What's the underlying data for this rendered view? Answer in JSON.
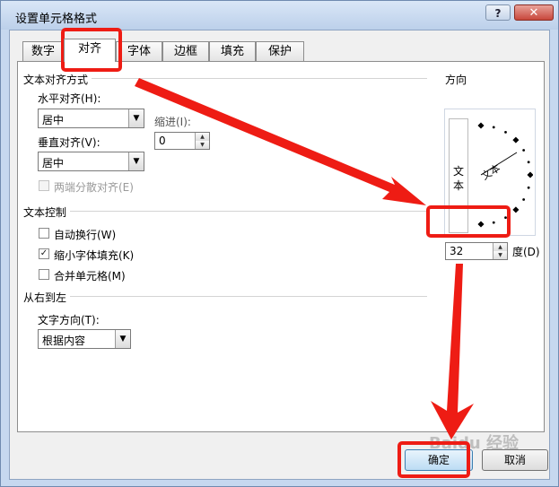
{
  "window": {
    "title": "设置单元格格式",
    "help_label": "?",
    "close_label": "✕"
  },
  "tabs": [
    {
      "label": "数字",
      "active": false
    },
    {
      "label": "对齐",
      "active": true
    },
    {
      "label": "字体",
      "active": false
    },
    {
      "label": "边框",
      "active": false
    },
    {
      "label": "填充",
      "active": false
    },
    {
      "label": "保护",
      "active": false
    }
  ],
  "text_alignment": {
    "group_label": "文本对齐方式",
    "horizontal_label": "水平对齐(H):",
    "horizontal_value": "居中",
    "indent_label": "缩进(I):",
    "indent_value": "0",
    "vertical_label": "垂直对齐(V):",
    "vertical_value": "居中",
    "distributed_label": "两端分散对齐(E)",
    "distributed_checked": false
  },
  "text_control": {
    "group_label": "文本控制",
    "wrap_label": "自动换行(W)",
    "wrap_checked": false,
    "shrink_label": "缩小字体填充(K)",
    "shrink_checked": true,
    "merge_label": "合并单元格(M)",
    "merge_checked": false
  },
  "rtl": {
    "group_label": "从右到左",
    "direction_label": "文字方向(T):",
    "direction_value": "根据内容"
  },
  "orientation": {
    "group_label": "方向",
    "vertical_text": "文本",
    "dial_text": "文本",
    "degrees_value": "32",
    "degrees_label": "度(D)",
    "angle": 32
  },
  "buttons": {
    "ok_label": "确定",
    "cancel_label": "取消"
  },
  "watermark": "Baidu 经验",
  "annotation_color": "#ee1c14"
}
